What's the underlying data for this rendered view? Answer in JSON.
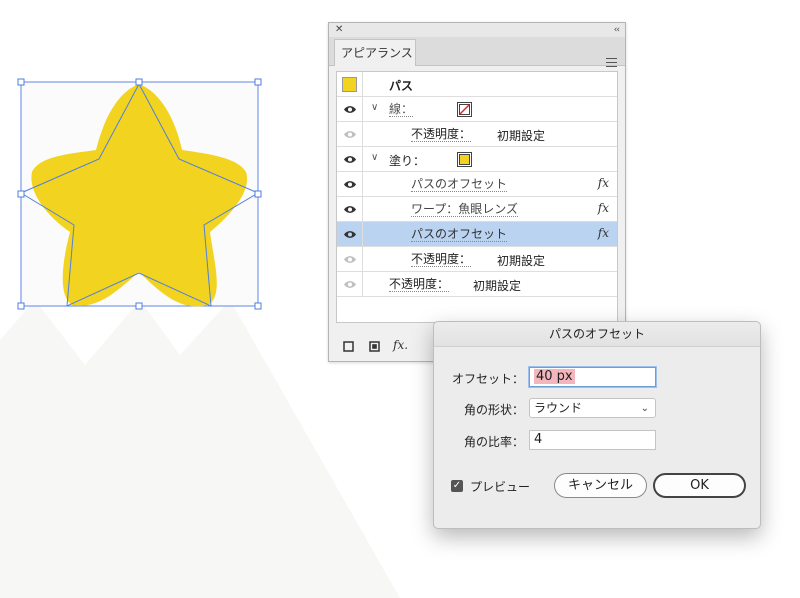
{
  "appearance_panel": {
    "close_glyph": "✕",
    "collapse_glyph": "‹‹",
    "tab_title": "アピアランス",
    "rows": {
      "path": {
        "label": "パス"
      },
      "stroke": {
        "label": "線："
      },
      "stroke_opacity": {
        "label": "不透明度：",
        "value": "初期設定"
      },
      "fill": {
        "label": "塗り："
      },
      "fill_offset_1": {
        "label": "パスのオフセット",
        "fx": "fx"
      },
      "fill_warp": {
        "label": "ワープ：魚眼レンズ",
        "fx": "fx"
      },
      "fill_offset_2": {
        "label": "パスのオフセット",
        "fx": "fx"
      },
      "fill_opacity": {
        "label": "不透明度：",
        "value": "初期設定"
      },
      "object_opacity": {
        "label": "不透明度：",
        "value": "初期設定"
      }
    },
    "footer": {
      "fx_label": "fx."
    }
  },
  "dialog": {
    "title": "パスのオフセット",
    "offset_label": "オフセット：",
    "offset_value": "40 px",
    "corner_label": "角の形状：",
    "corner_value": "ラウンド",
    "miter_label": "角の比率：",
    "miter_value": "4",
    "preview_label": "プレビュー",
    "preview_checked": true,
    "cancel_label": "キャンセル",
    "ok_label": "OK"
  },
  "colors": {
    "star_fill": "#f2d320",
    "selection": "#4f7fe0",
    "selected_row": "#b9d3f0",
    "background_shapes": "#f7f7f5"
  },
  "icons": {
    "eye": "eye-icon",
    "chevron": "chevron-down-icon",
    "fx": "fx-icon",
    "stroke_swatch": "no-stroke-swatch",
    "fill_swatch": "yellow-fill-swatch",
    "new_stroke": "square-outline-icon",
    "new_fill": "square-filled-icon",
    "menu": "hamburger-menu-icon"
  }
}
